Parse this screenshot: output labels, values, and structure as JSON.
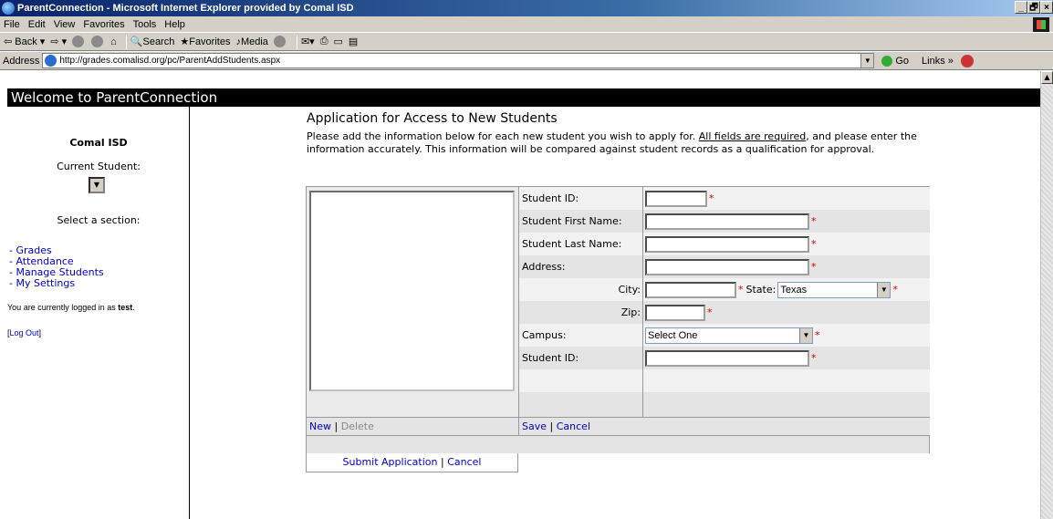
{
  "window": {
    "title": "ParentConnection - Microsoft Internet Explorer provided by Comal ISD",
    "min_label": "_",
    "max_label": "🗗",
    "close_label": "×"
  },
  "menu": [
    "File",
    "Edit",
    "View",
    "Favorites",
    "Tools",
    "Help"
  ],
  "toolbar": {
    "back": "Back",
    "search": "Search",
    "favorites": "Favorites",
    "media": "Media"
  },
  "address": {
    "label": "Address",
    "url": "http://grades.comalisd.org/pc/ParentAddStudents.aspx",
    "go": "Go",
    "links": "Links »"
  },
  "banner": "Welcome to ParentConnection",
  "sidebar": {
    "district": "Comal ISD",
    "current_student_label": "Current Student:",
    "select_section_label": "Select a section:",
    "nav": [
      "- Grades",
      "- Attendance",
      "- Manage Students",
      "- My Settings"
    ],
    "logged_in_prefix": "You are currently logged in as ",
    "logged_in_user": "test",
    "logged_in_suffix": ".",
    "logout_open": "[",
    "logout_label": "Log Out",
    "logout_close": "]"
  },
  "main": {
    "title": "Application for Access to New Students",
    "intro_1": "Please add the information below for each new student you wish to apply for.  ",
    "intro_required": "All fields are required",
    "intro_2": ", and please enter the information accurately.  This information will be compared against student records as a qualification for approval."
  },
  "form": {
    "student_id_label": "Student ID:",
    "first_name_label": "Student First Name:",
    "last_name_label": "Student Last Name:",
    "address_label": "Address:",
    "city_label": "City:",
    "state_label": "State:",
    "state_value": "Texas",
    "zip_label": "Zip:",
    "campus_label": "Campus:",
    "campus_value": "Select One",
    "student_id2_label": "Student ID:",
    "required_mark": "*"
  },
  "actions": {
    "new": "New",
    "delete": "Delete",
    "save": "Save",
    "cancel": "Cancel",
    "separator": "|",
    "submit": "Submit Application",
    "submit_cancel": "Cancel"
  }
}
